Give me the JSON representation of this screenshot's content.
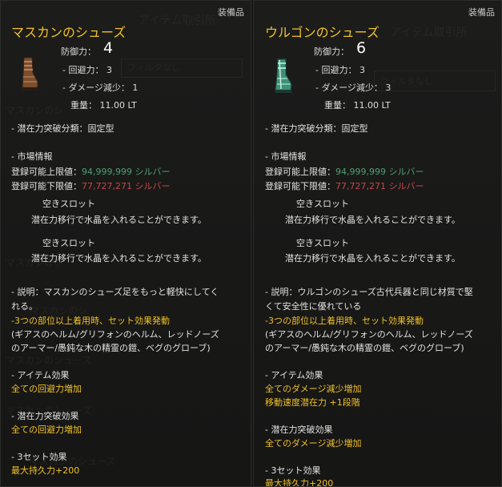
{
  "panels": [
    {
      "category": "装備品",
      "name": "マスカンのシューズ",
      "defense_label": "防御力：",
      "defense_value": "4",
      "evasion": "- 回避力：  3",
      "dmg_reduction": "- ダメージ減少：  1",
      "weight": "重量：  11.00 LT",
      "breakthrough_type": "- 潜在力突破分類：固定型",
      "market_header": "- 市場情報",
      "market_max_label": "登録可能上限値：",
      "market_max_value": "94,999,999 シルバー",
      "market_min_label": "登録可能下限値：",
      "market_min_value": "77,727,271 シルバー",
      "slot1_title": "空きスロット",
      "slot1_desc": "潜在力移行で水晶を入れることができます。",
      "slot2_title": "空きスロット",
      "slot2_desc": "潜在力移行で水晶を入れることができます。",
      "desc_line1": "- 説明：マスカンのシューズ足をもっと軽快にしてく",
      "desc_line2": "れる。",
      "set_line1": "-3つの部位以上着用時、セット効果発動",
      "set_line2": "(ギアスのヘルム/グリフォンのヘルム、レッドノーズ",
      "set_line3": "のアーマー/愚鈍な木の精霊の鎧、ベグのグローブ)",
      "item_effect_header": "- アイテム効果",
      "item_effect_1": "全ての回避力増加",
      "item_effect_2": "",
      "break_header": "- 潜在力突破効果",
      "break_effect": "全ての回避力増加",
      "set3_header": "- 3セット効果",
      "set3_effect": "最大持久力+200"
    },
    {
      "category": "装備品",
      "name": "ウルゴンのシューズ",
      "defense_label": "防御力：",
      "defense_value": "6",
      "evasion": "- 回避力：  3",
      "dmg_reduction": "- ダメージ減少：  3",
      "weight": "重量：  11.00 LT",
      "breakthrough_type": "- 潜在力突破分類：固定型",
      "market_header": "- 市場情報",
      "market_max_label": "登録可能上限値：",
      "market_max_value": "94,999,999 シルバー",
      "market_min_label": "登録可能下限値：",
      "market_min_value": "77,727,271 シルバー",
      "slot1_title": "空きスロット",
      "slot1_desc": "潜在力移行で水晶を入れることができます。",
      "slot2_title": "空きスロット",
      "slot2_desc": "潜在力移行で水晶を入れることができます。",
      "desc_line1": "- 説明：ウルゴンのシューズ古代兵器と同じ材質で堅",
      "desc_line2": "くて安全性に優れている",
      "set_line1": "-3つの部位以上着用時、セット効果発動",
      "set_line2": "(ギアスのヘルム/グリフォンのヘルム、レッドノーズ",
      "set_line3": "のアーマー/愚鈍な木の精霊の鎧、ベグのグローブ)",
      "item_effect_header": "- アイテム効果",
      "item_effect_1": "全てのダメージ減少増加",
      "item_effect_2": "移動速度潜在力 +1段階",
      "break_header": "- 潜在力突破効果",
      "break_effect": "全てのダメージ減少増加",
      "set3_header": "- 3セット効果",
      "set3_effect": "最大持久力+200"
    }
  ],
  "background": {
    "ghost_title": "アイテム取引所",
    "ghost_filter": "フィルタなし",
    "ghost_items": [
      "マスカンのシ",
      "マスカンのシ",
      "マスカンのシ",
      "マスカンのシューズ",
      "マスカンのシューズ",
      "マスカンのシューズ"
    ]
  },
  "colors": {
    "name": "#f2c227",
    "green_value": "#4fa070",
    "red_value": "#c54848",
    "yellow_effect": "#f1c126"
  },
  "icons": [
    "leather-boots-icon",
    "jade-boots-icon"
  ]
}
